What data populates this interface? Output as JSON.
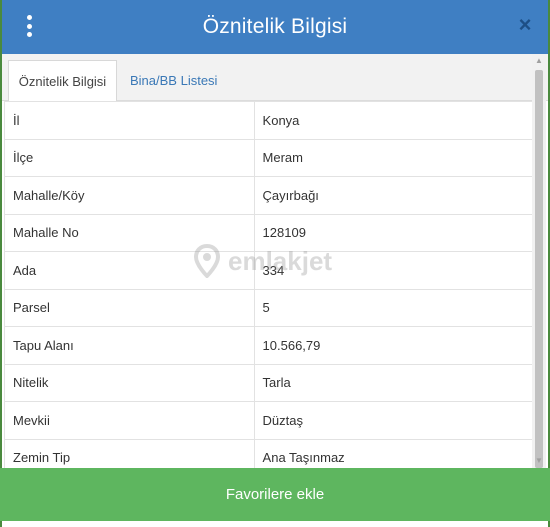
{
  "header": {
    "title": "Öznitelik Bilgisi",
    "close_symbol": "×"
  },
  "tabs": [
    {
      "label": "Öznitelik Bilgisi",
      "active": true
    },
    {
      "label": "Bina/BB Listesi",
      "active": false
    }
  ],
  "rows": [
    {
      "key": "İl",
      "value": "Konya"
    },
    {
      "key": "İlçe",
      "value": "Meram"
    },
    {
      "key": "Mahalle/Köy",
      "value": "Çayırbağı"
    },
    {
      "key": "Mahalle No",
      "value": "128109"
    },
    {
      "key": "Ada",
      "value": "334"
    },
    {
      "key": "Parsel",
      "value": "5"
    },
    {
      "key": "Tapu Alanı",
      "value": "10.566,79"
    },
    {
      "key": "Nitelik",
      "value": "Tarla"
    },
    {
      "key": "Mevkii",
      "value": "Düztaş"
    },
    {
      "key": "Zemin Tip",
      "value": "Ana Taşınmaz"
    }
  ],
  "watermark": "emlakjet",
  "footer": {
    "button_label": "Favorilere ekle"
  },
  "colors": {
    "header": "#3f7fc3",
    "footer": "#5eb65f",
    "tab_link": "#3a78b6"
  },
  "icons": [
    "menu-kebab-icon",
    "close-icon",
    "scroll-up-arrow-icon",
    "scroll-down-arrow-icon"
  ]
}
